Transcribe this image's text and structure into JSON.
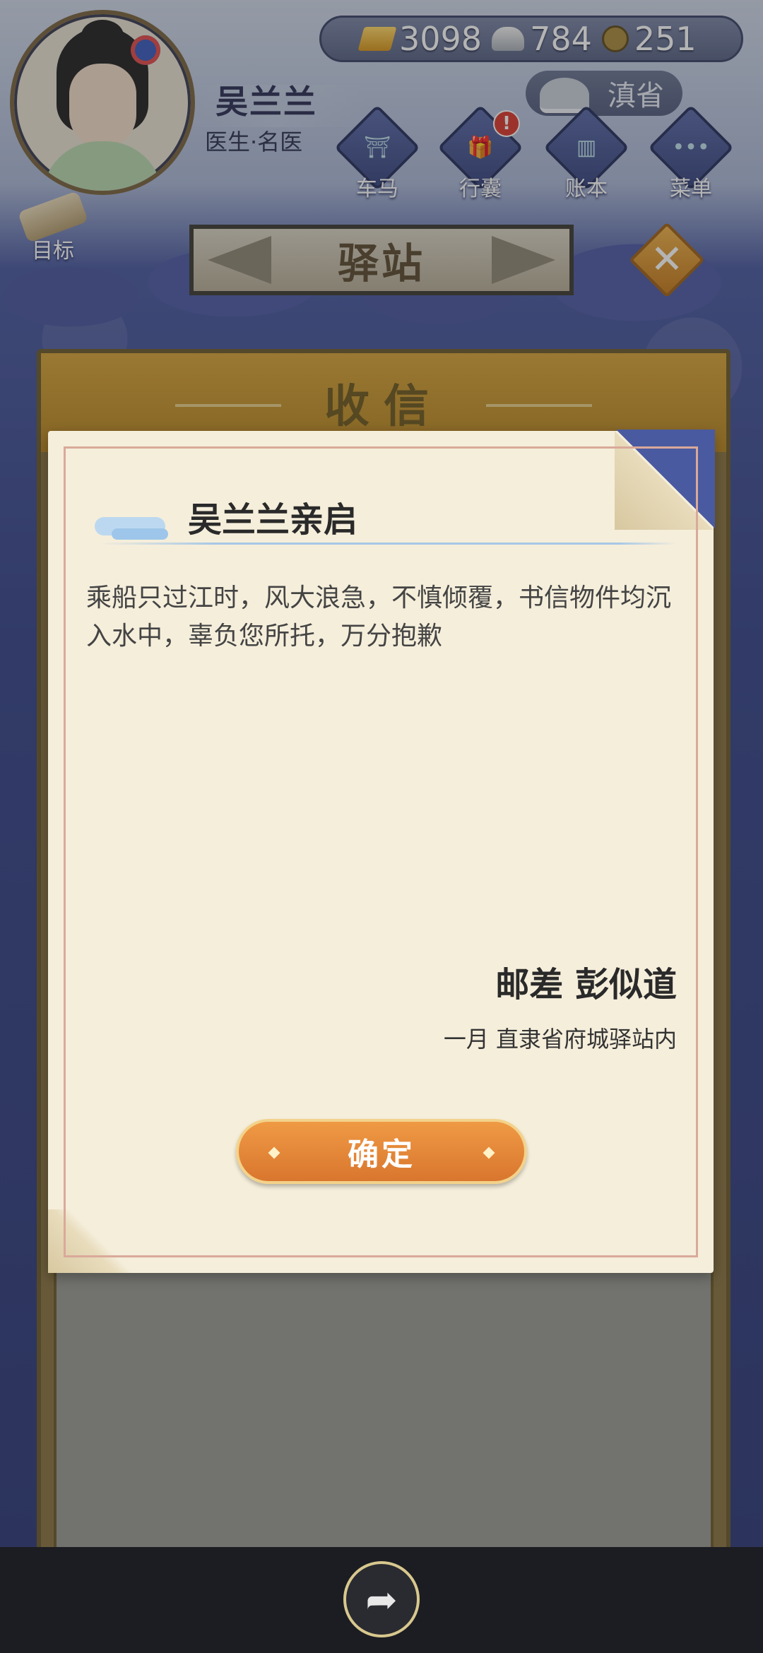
{
  "player": {
    "name": "吴兰兰",
    "title": "医生·名医"
  },
  "currency": {
    "gold": "3098",
    "silver": "784",
    "coins": "251"
  },
  "region": "滇省",
  "menu": [
    {
      "label": "车马",
      "icon": "carriage-icon"
    },
    {
      "label": "行囊",
      "icon": "bag-icon",
      "alert": "!"
    },
    {
      "label": "账本",
      "icon": "ledger-icon"
    },
    {
      "label": "菜单",
      "icon": "more-icon"
    }
  ],
  "goal_label": "目标",
  "screen_title": "驿站",
  "inbox_title": "收信",
  "letter": {
    "recipient": "吴兰兰亲启",
    "body": "乘船只过江时，风大浪急，不慎倾覆，书信物件均沉入水中，辜负您所托，万分抱歉",
    "sender": "邮差 彭似道",
    "date_location": "一月 直隶省府城驿站内"
  },
  "confirm_label": "确定",
  "icons": {
    "close": "close-icon",
    "share": "share-icon"
  }
}
